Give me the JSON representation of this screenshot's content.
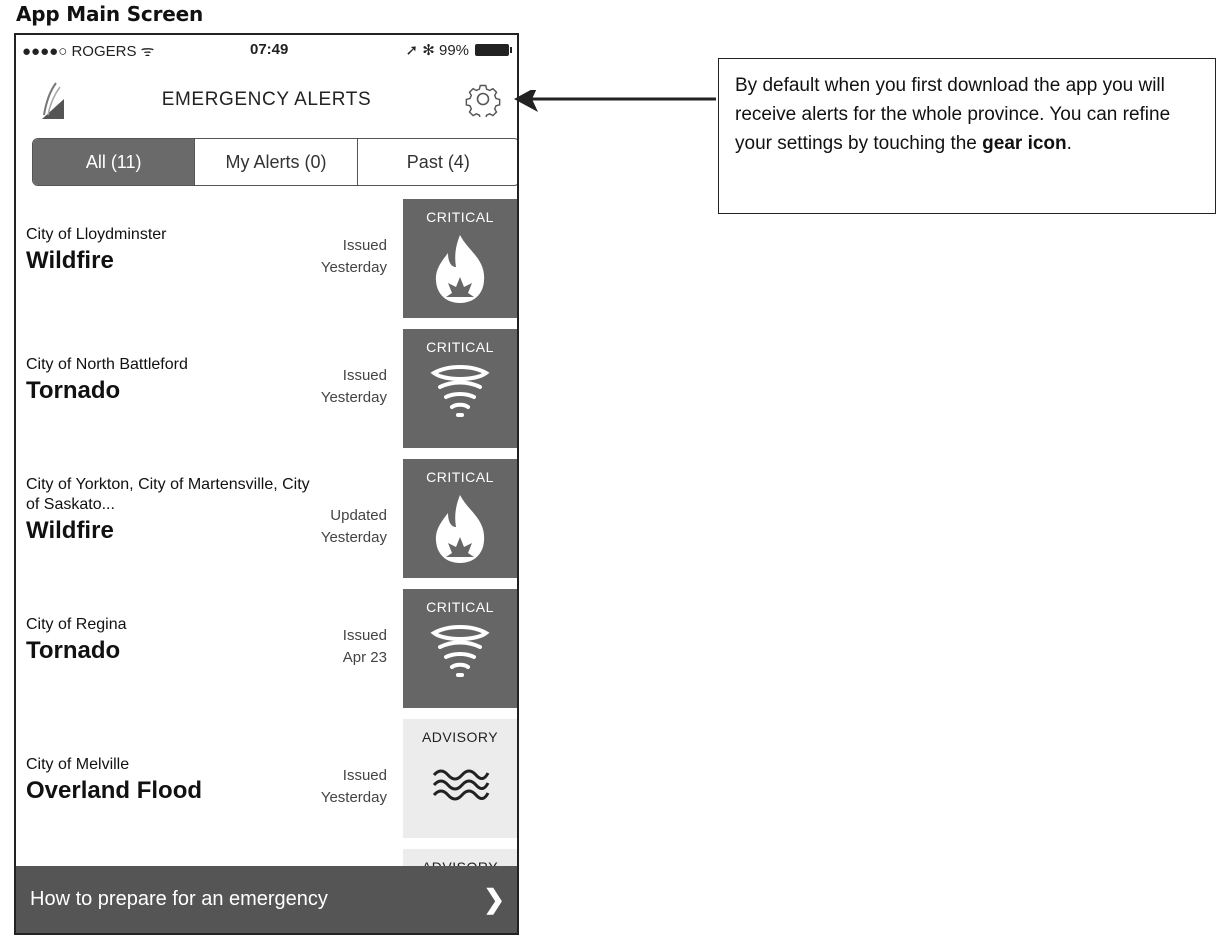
{
  "doc_title": "App Main Screen",
  "status_bar": {
    "carrier": "●●●●○ ROGERS ᯤ",
    "time": "07:49",
    "right": "➚ ✻ 99%"
  },
  "header": {
    "title": "EMERGENCY ALERTS",
    "logo_icon": "feather-logo-icon",
    "settings_icon": "gear-icon"
  },
  "tabs": [
    {
      "label": "All (11)"
    },
    {
      "label": "My Alerts (0)"
    },
    {
      "label": "Past (4)"
    }
  ],
  "alerts": [
    {
      "location": "City of Lloydminster",
      "type": "Wildfire",
      "status": "Issued",
      "when": "Yesterday",
      "level": "CRITICAL",
      "icon": "fire-icon"
    },
    {
      "location": "City of North Battleford",
      "type": "Tornado",
      "status": "Issued",
      "when": "Yesterday",
      "level": "CRITICAL",
      "icon": "tornado-icon"
    },
    {
      "location": "City of Yorkton, City of Martensville, City of Saskato...",
      "type": "Wildfire",
      "status": "Updated",
      "when": "Yesterday",
      "level": "CRITICAL",
      "icon": "fire-icon"
    },
    {
      "location": "City of Regina",
      "type": "Tornado",
      "status": "Issued",
      "when": "Apr 23",
      "level": "CRITICAL",
      "icon": "tornado-icon"
    },
    {
      "location": "City of Melville",
      "type": "Overland Flood",
      "status": "Issued",
      "when": "Yesterday",
      "level": "ADVISORY",
      "icon": "flood-icon"
    },
    {
      "level": "ADVISORY"
    }
  ],
  "bottom_bar": {
    "label": "How to prepare for an emergency",
    "icon": "chevron-right-icon"
  },
  "callout": {
    "text_before": "By default when you first download the app you will receive alerts for the whole province. You can refine your settings by touching the ",
    "bold": "gear icon",
    "text_after": "."
  },
  "colors": {
    "critical": "#666666",
    "advisory": "#ececec",
    "bottom_bar": "#555555",
    "active_tab": "#6a6a6a"
  }
}
